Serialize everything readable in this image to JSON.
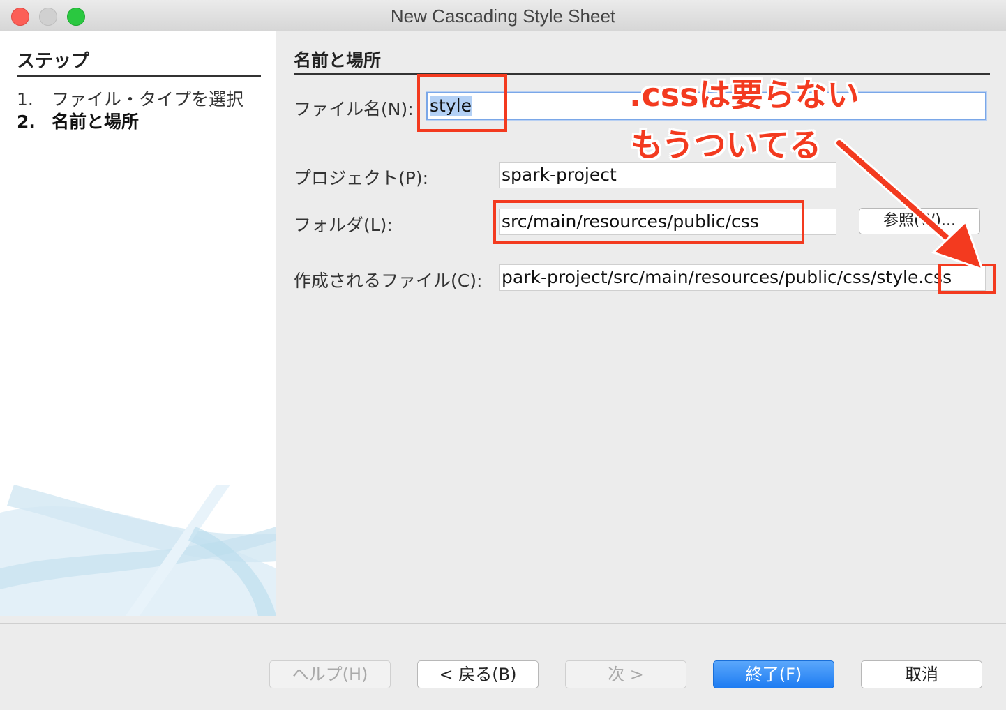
{
  "window": {
    "title": "New Cascading Style Sheet"
  },
  "steps": {
    "title": "ステップ",
    "items": [
      {
        "num": "1.",
        "label": "ファイル・タイプを選択"
      },
      {
        "num": "2.",
        "label": "名前と場所"
      }
    ]
  },
  "form": {
    "section_title": "名前と場所",
    "filename_label": "ファイル名(N):",
    "filename_value": "style",
    "project_label": "プロジェクト(P):",
    "project_value": "spark-project",
    "folder_label": "フォルダ(L):",
    "folder_value": "src/main/resources/public/css",
    "browse_label": "参照(W)...",
    "created_label": "作成されるファイル(C):",
    "created_value": "park-project/src/main/resources/public/css/style.css"
  },
  "annotations": {
    "line1": ".cssは要らない",
    "line2": "もうついてる"
  },
  "buttons": {
    "help": "ヘルプ(H)",
    "back": "< 戻る(B)",
    "next": "次 >",
    "finish": "終了(F)",
    "cancel": "取消"
  },
  "colors": {
    "annotation_red": "#f33a1f",
    "primary_blue": "#1e7cf2"
  }
}
